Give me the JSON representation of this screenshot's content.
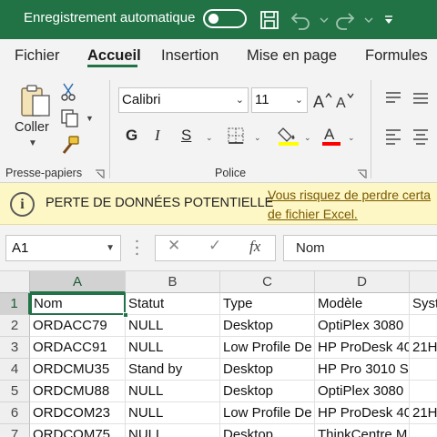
{
  "titlebar": {
    "autosave_label": "Enregistrement automatique",
    "icons": [
      "save-icon",
      "undo-icon",
      "redo-icon",
      "customize-qat-icon"
    ]
  },
  "tabs": [
    "Fichier",
    "Accueil",
    "Insertion",
    "Mise en page",
    "Formules"
  ],
  "active_tab": "Accueil",
  "ribbon": {
    "clipboard": {
      "paste_label": "Coller",
      "group_label": "Presse-papiers"
    },
    "font": {
      "font_name": "Calibri",
      "font_size": "11",
      "bold": "G",
      "italic": "I",
      "underline": "S",
      "group_label": "Police",
      "fill_color": "#ffff00",
      "font_color": "#ff0000"
    }
  },
  "infobar": {
    "title": "PERTE DE DONNÉES POTENTIELLE",
    "message_line1": "Vous risquez de perdre certa",
    "message_line2": "de fichier Excel."
  },
  "formula_bar": {
    "name_box": "A1",
    "formula": "Nom"
  },
  "sheet": {
    "columns": [
      "A",
      "B",
      "C",
      "D",
      ""
    ],
    "rows": [
      {
        "num": "1",
        "cells": [
          "Nom",
          "Statut",
          "Type",
          "Modèle",
          "Syst"
        ]
      },
      {
        "num": "2",
        "cells": [
          "ORDACC79",
          "NULL",
          "Desktop",
          "OptiPlex 3080",
          ""
        ]
      },
      {
        "num": "3",
        "cells": [
          "ORDACC91",
          "NULL",
          "Low Profile De",
          "HP ProDesk 40",
          "21H"
        ]
      },
      {
        "num": "4",
        "cells": [
          "ORDCMU35",
          "Stand by",
          "Desktop",
          "HP Pro 3010 S",
          ""
        ]
      },
      {
        "num": "5",
        "cells": [
          "ORDCMU88",
          "NULL",
          "Desktop",
          "OptiPlex 3080",
          ""
        ]
      },
      {
        "num": "6",
        "cells": [
          "ORDCOM23",
          "NULL",
          "Low Profile De",
          "HP ProDesk 40",
          "21H"
        ]
      },
      {
        "num": "7",
        "cells": [
          "ORDCOM75",
          "NULL",
          "Desktop",
          "ThinkCentre M",
          ""
        ]
      }
    ]
  },
  "colors": {
    "brand_green": "#217346",
    "info_bg": "#fdf6c5"
  }
}
